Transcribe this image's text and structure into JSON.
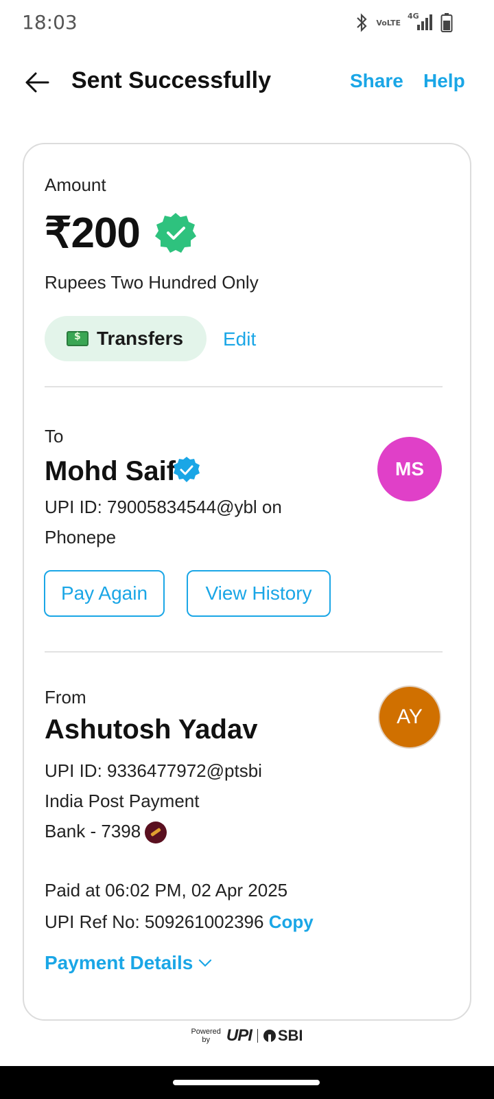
{
  "status_bar": {
    "time": "18:03",
    "icons": [
      "bluetooth-icon",
      "volte-icon",
      "signal-icon",
      "battery-icon"
    ],
    "volte_top": "Vo",
    "volte_bottom": "LTE",
    "network_label": "4G"
  },
  "header": {
    "title": "Sent Successfully",
    "share_label": "Share",
    "help_label": "Help"
  },
  "amount": {
    "label": "Amount",
    "value": "₹200",
    "in_words": "Rupees Two Hundred Only",
    "category": "Transfers",
    "edit_label": "Edit"
  },
  "recipient": {
    "section_label": "To",
    "name": "Mohd Saif",
    "upi_line1": "UPI ID: 79005834544@ybl on",
    "upi_line2": "Phonepe",
    "initials": "MS",
    "avatar_color": "#e040c8",
    "pay_again_label": "Pay Again",
    "view_history_label": "View History"
  },
  "sender": {
    "section_label": "From",
    "name": "Ashutosh Yadav",
    "upi_line": "UPI ID: 9336477972@ptsbi",
    "bank_line1": "India Post Payment",
    "bank_line2": "Bank - 7398",
    "initials": "AY",
    "avatar_color": "#d07000"
  },
  "transaction": {
    "paid_at": "Paid at 06:02 PM, 02 Apr 2025",
    "ref_text": "UPI Ref No: 509261002396",
    "copy_label": "Copy",
    "details_label": "Payment Details"
  },
  "footer": {
    "powered_line1": "Powered",
    "powered_line2": "by",
    "upi_logo": "UPI",
    "bank_logo": "SBI"
  },
  "colors": {
    "accent": "#1aa6e6",
    "success": "#2ec27e",
    "pill_bg": "#e3f4ea"
  }
}
